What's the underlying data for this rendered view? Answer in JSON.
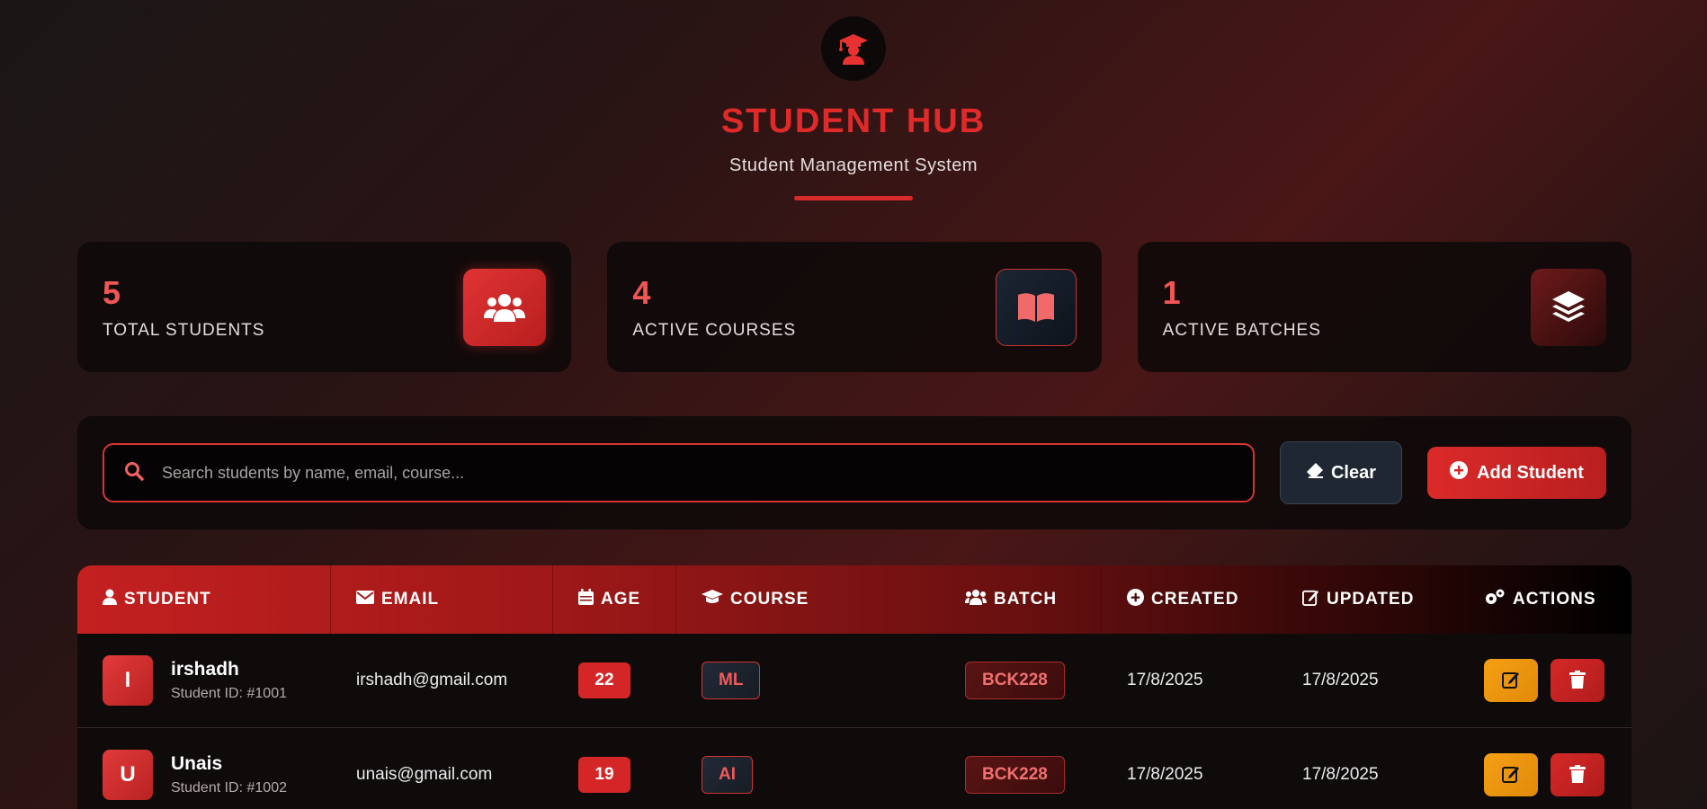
{
  "header": {
    "title": "STUDENT HUB",
    "subtitle": "Student Management System",
    "logo_icon": "graduate-icon"
  },
  "stats": [
    {
      "value": "5",
      "label": "TOTAL STUDENTS",
      "icon": "users-icon"
    },
    {
      "value": "4",
      "label": "ACTIVE COURSES",
      "icon": "book-icon"
    },
    {
      "value": "1",
      "label": "ACTIVE BATCHES",
      "icon": "layers-icon"
    }
  ],
  "toolbar": {
    "search_placeholder": "Search students by name, email, course...",
    "clear_label": "Clear",
    "add_label": "Add Student"
  },
  "table": {
    "headers": {
      "student": "STUDENT",
      "email": "EMAIL",
      "age": "AGE",
      "course": "COURSE",
      "batch": "BATCH",
      "created": "CREATED",
      "updated": "UPDATED",
      "actions": "ACTIONS"
    },
    "rows": [
      {
        "initial": "I",
        "name": "irshadh",
        "student_id": "Student ID: #1001",
        "email": "irshadh@gmail.com",
        "age": "22",
        "course": "ML",
        "batch": "BCK228",
        "created": "17/8/2025",
        "updated": "17/8/2025"
      },
      {
        "initial": "U",
        "name": "Unais",
        "student_id": "Student ID: #1002",
        "email": "unais@gmail.com",
        "age": "19",
        "course": "AI",
        "batch": "BCK228",
        "created": "17/8/2025",
        "updated": "17/8/2025"
      }
    ]
  },
  "colors": {
    "accent": "#e02a2a",
    "edit": "#f5a013",
    "delete": "#d62828"
  }
}
